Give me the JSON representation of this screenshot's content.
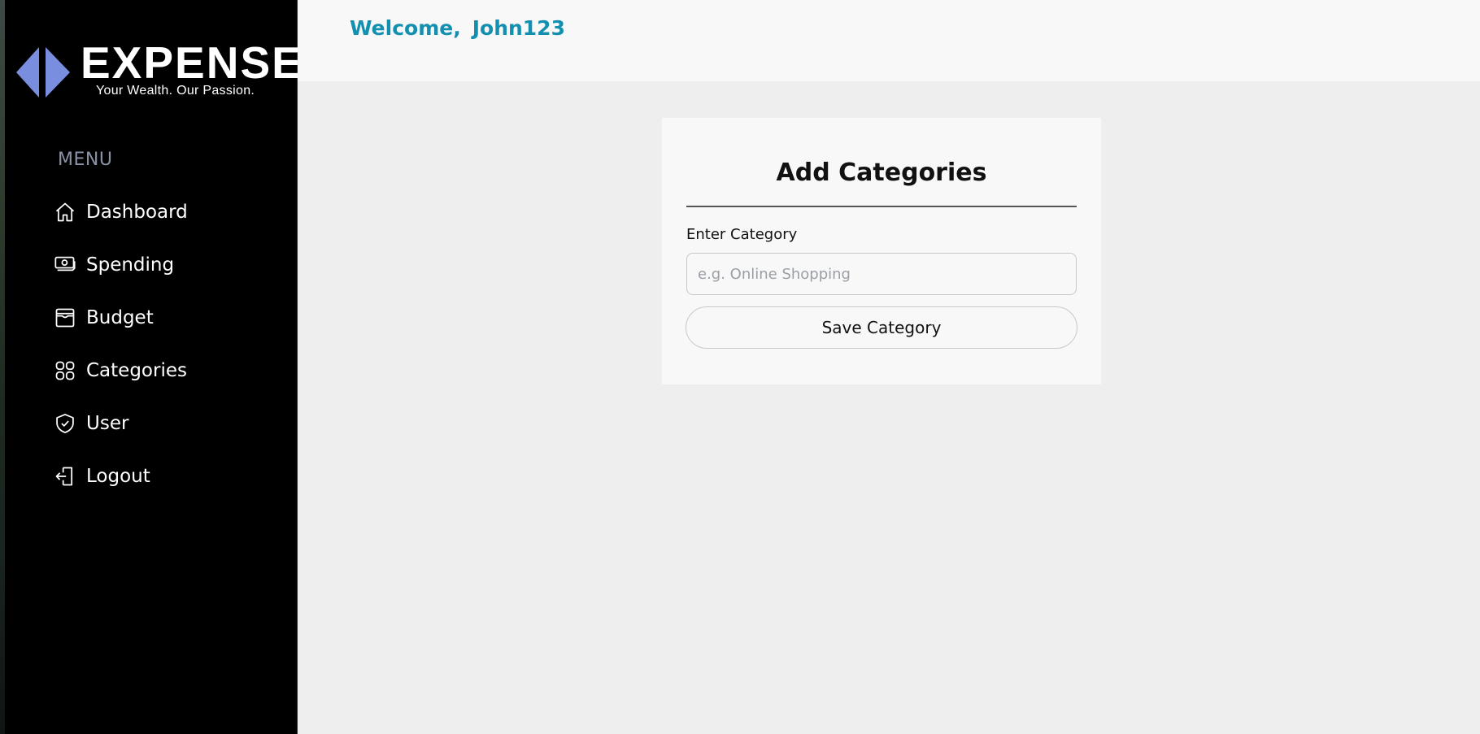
{
  "brand": {
    "wordmark": "EXPENSE",
    "tagline": "Your Wealth. Our Passion.",
    "logo_icon": "expense-logo-mark",
    "accent_color": "#7a8ee0"
  },
  "sidebar": {
    "menu_heading": "MENU",
    "items": [
      {
        "label": "Dashboard",
        "icon": "home-icon"
      },
      {
        "label": "Spending",
        "icon": "money-icon"
      },
      {
        "label": "Budget",
        "icon": "wallet-icon"
      },
      {
        "label": "Categories",
        "icon": "categories-icon"
      },
      {
        "label": "User",
        "icon": "shield-check-icon"
      },
      {
        "label": "Logout",
        "icon": "logout-icon"
      }
    ]
  },
  "header": {
    "welcome_text": "Welcome,",
    "username": "John123",
    "welcome_color": "#1390b0"
  },
  "form": {
    "title": "Add Categories",
    "field_label": "Enter Category",
    "input_value": "",
    "input_placeholder": "e.g. Online Shopping",
    "save_label": "Save Category"
  }
}
